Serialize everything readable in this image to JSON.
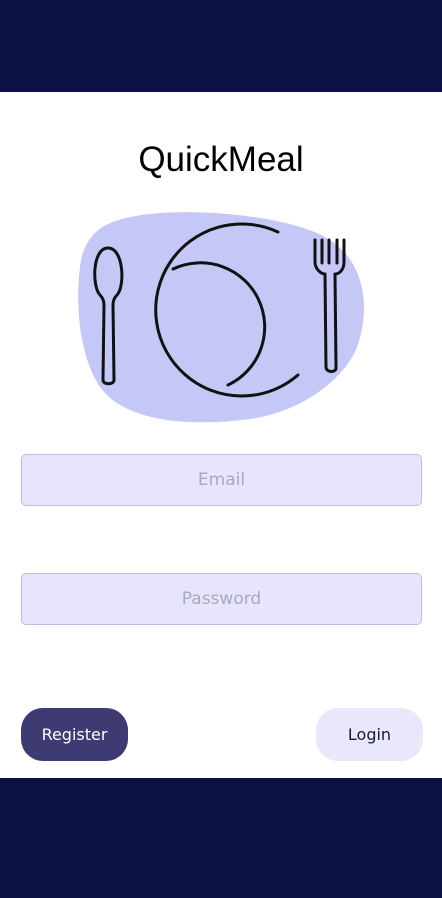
{
  "app": {
    "title": "QuickMeal"
  },
  "illustration": {
    "icon": "plate-fork-spoon-icon",
    "blob_color": "#c5c8f7"
  },
  "form": {
    "email_placeholder": "Email",
    "password_placeholder": "Password"
  },
  "actions": {
    "register_label": "Register",
    "login_label": "Login"
  },
  "colors": {
    "bar": "#0c1344",
    "register_bg": "#3d3b72",
    "login_bg": "#e9e8fb",
    "field_bg": "#e6e5fb"
  }
}
